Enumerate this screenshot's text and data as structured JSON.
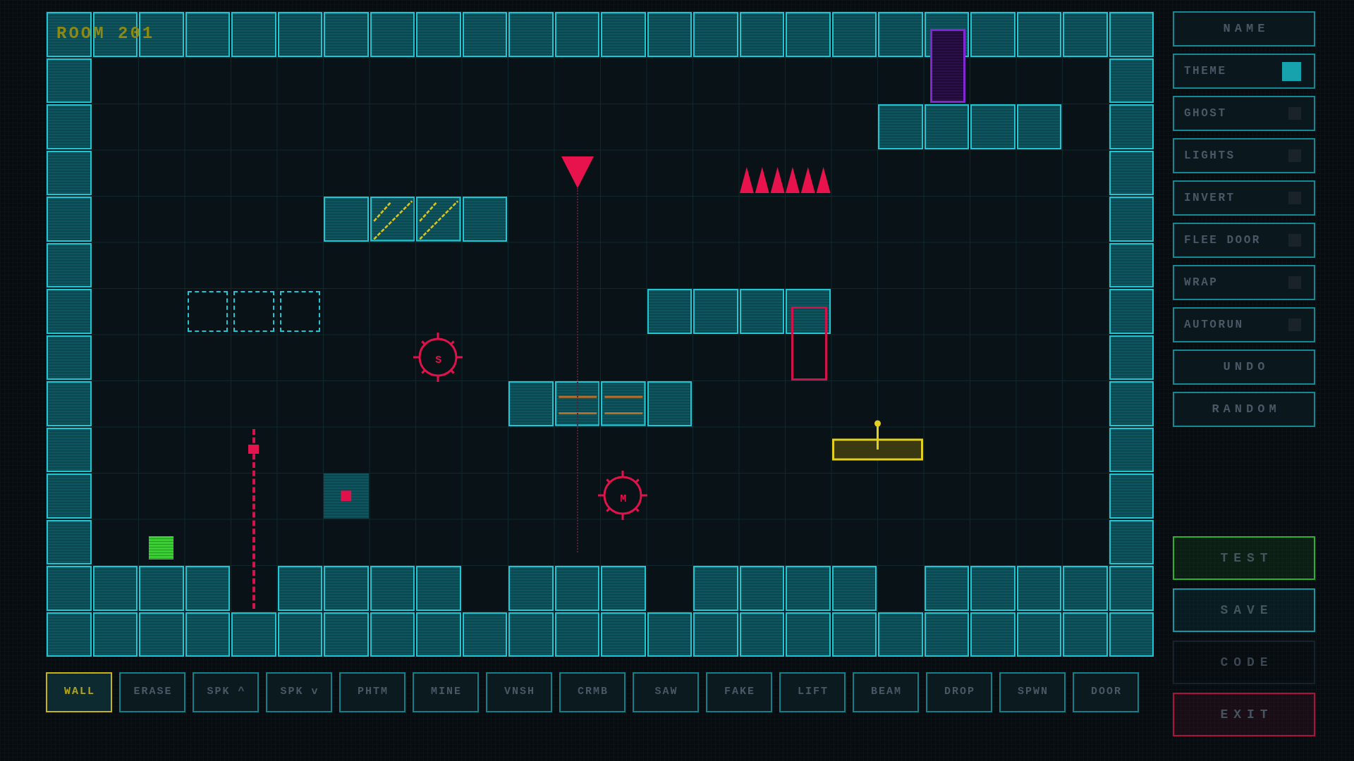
{
  "title": "ROOM 201",
  "map": {
    "rows": [
      [
        {
          "kind": "wall"
        },
        {
          "kind": "wall"
        },
        {
          "kind": "wall"
        },
        {
          "kind": "wall"
        },
        {
          "kind": "wall"
        },
        {
          "kind": "wall"
        },
        {
          "kind": "wall"
        },
        {
          "kind": "wall"
        },
        {
          "kind": "wall"
        },
        {
          "kind": "wall"
        },
        {
          "kind": "wall"
        },
        {
          "kind": "wall"
        },
        {
          "kind": "wall"
        },
        {
          "kind": "wall"
        },
        {
          "kind": "wall"
        },
        {
          "kind": "wall"
        },
        {
          "kind": "wall"
        },
        {
          "kind": "wall"
        },
        {
          "kind": "wall"
        },
        {
          "kind": "wall"
        },
        {
          "kind": "wall"
        },
        {
          "kind": "wall"
        },
        {
          "kind": "wall"
        },
        {
          "kind": "wall"
        }
      ],
      [
        {
          "kind": "wall"
        },
        {
          "kind": "empty"
        },
        {
          "kind": "empty"
        },
        {
          "kind": "empty"
        },
        {
          "kind": "empty"
        },
        {
          "kind": "empty"
        },
        {
          "kind": "empty"
        },
        {
          "kind": "empty"
        },
        {
          "kind": "empty"
        },
        {
          "kind": "empty"
        },
        {
          "kind": "empty"
        },
        {
          "kind": "empty"
        },
        {
          "kind": "empty"
        },
        {
          "kind": "empty"
        },
        {
          "kind": "empty"
        },
        {
          "kind": "empty"
        },
        {
          "kind": "empty"
        },
        {
          "kind": "empty"
        },
        {
          "kind": "empty"
        },
        {
          "kind": "door"
        },
        {
          "kind": "empty"
        },
        {
          "kind": "empty"
        },
        {
          "kind": "empty"
        },
        {
          "kind": "wall"
        }
      ],
      [
        {
          "kind": "wall"
        },
        {
          "kind": "empty"
        },
        {
          "kind": "empty"
        },
        {
          "kind": "empty"
        },
        {
          "kind": "empty"
        },
        {
          "kind": "empty"
        },
        {
          "kind": "empty"
        },
        {
          "kind": "empty"
        },
        {
          "kind": "empty"
        },
        {
          "kind": "empty"
        },
        {
          "kind": "empty"
        },
        {
          "kind": "empty"
        },
        {
          "kind": "empty"
        },
        {
          "kind": "empty"
        },
        {
          "kind": "empty"
        },
        {
          "kind": "empty"
        },
        {
          "kind": "empty"
        },
        {
          "kind": "empty"
        },
        {
          "kind": "wall"
        },
        {
          "kind": "wall"
        },
        {
          "kind": "wall"
        },
        {
          "kind": "wall"
        },
        {
          "kind": "empty"
        },
        {
          "kind": "wall"
        }
      ],
      [
        {
          "kind": "wall"
        },
        {
          "kind": "empty"
        },
        {
          "kind": "empty"
        },
        {
          "kind": "empty"
        },
        {
          "kind": "empty"
        },
        {
          "kind": "empty"
        },
        {
          "kind": "empty"
        },
        {
          "kind": "empty"
        },
        {
          "kind": "empty"
        },
        {
          "kind": "empty"
        },
        {
          "kind": "empty"
        },
        {
          "kind": "drop"
        },
        {
          "kind": "empty"
        },
        {
          "kind": "empty"
        },
        {
          "kind": "empty"
        },
        {
          "kind": "spikes"
        },
        {
          "kind": "spikes"
        },
        {
          "kind": "empty"
        },
        {
          "kind": "empty"
        },
        {
          "kind": "empty"
        },
        {
          "kind": "empty"
        },
        {
          "kind": "empty"
        },
        {
          "kind": "empty"
        },
        {
          "kind": "wall"
        }
      ],
      [
        {
          "kind": "wall"
        },
        {
          "kind": "empty"
        },
        {
          "kind": "empty"
        },
        {
          "kind": "empty"
        },
        {
          "kind": "empty"
        },
        {
          "kind": "empty"
        },
        {
          "kind": "wall"
        },
        {
          "kind": "crumble"
        },
        {
          "kind": "crumble"
        },
        {
          "kind": "wall"
        },
        {
          "kind": "empty"
        },
        {
          "kind": "empty"
        },
        {
          "kind": "empty"
        },
        {
          "kind": "empty"
        },
        {
          "kind": "empty"
        },
        {
          "kind": "empty"
        },
        {
          "kind": "empty"
        },
        {
          "kind": "empty"
        },
        {
          "kind": "empty"
        },
        {
          "kind": "empty"
        },
        {
          "kind": "empty"
        },
        {
          "kind": "empty"
        },
        {
          "kind": "empty"
        },
        {
          "kind": "wall"
        }
      ],
      [
        {
          "kind": "wall"
        },
        {
          "kind": "empty"
        },
        {
          "kind": "empty"
        },
        {
          "kind": "empty"
        },
        {
          "kind": "empty"
        },
        {
          "kind": "empty"
        },
        {
          "kind": "empty"
        },
        {
          "kind": "empty"
        },
        {
          "kind": "empty"
        },
        {
          "kind": "empty"
        },
        {
          "kind": "empty"
        },
        {
          "kind": "empty"
        },
        {
          "kind": "empty"
        },
        {
          "kind": "empty"
        },
        {
          "kind": "empty"
        },
        {
          "kind": "empty"
        },
        {
          "kind": "empty"
        },
        {
          "kind": "empty"
        },
        {
          "kind": "empty"
        },
        {
          "kind": "empty"
        },
        {
          "kind": "empty"
        },
        {
          "kind": "empty"
        },
        {
          "kind": "empty"
        },
        {
          "kind": "wall"
        }
      ],
      [
        {
          "kind": "wall"
        },
        {
          "kind": "empty"
        },
        {
          "kind": "empty"
        },
        {
          "kind": "phantom"
        },
        {
          "kind": "phantom"
        },
        {
          "kind": "phantom"
        },
        {
          "kind": "empty"
        },
        {
          "kind": "empty"
        },
        {
          "kind": "empty"
        },
        {
          "kind": "empty"
        },
        {
          "kind": "empty"
        },
        {
          "kind": "empty"
        },
        {
          "kind": "empty"
        },
        {
          "kind": "wall"
        },
        {
          "kind": "wall"
        },
        {
          "kind": "wall"
        },
        {
          "kind": "wall"
        },
        {
          "kind": "empty"
        },
        {
          "kind": "empty"
        },
        {
          "kind": "empty"
        },
        {
          "kind": "empty"
        },
        {
          "kind": "empty"
        },
        {
          "kind": "empty"
        },
        {
          "kind": "wall"
        }
      ],
      [
        {
          "kind": "wall"
        },
        {
          "kind": "empty"
        },
        {
          "kind": "empty"
        },
        {
          "kind": "empty"
        },
        {
          "kind": "empty"
        },
        {
          "kind": "empty"
        },
        {
          "kind": "empty"
        },
        {
          "kind": "empty"
        },
        {
          "kind": "saw",
          "label": "S"
        },
        {
          "kind": "empty"
        },
        {
          "kind": "empty"
        },
        {
          "kind": "empty"
        },
        {
          "kind": "empty"
        },
        {
          "kind": "empty"
        },
        {
          "kind": "empty"
        },
        {
          "kind": "empty"
        },
        {
          "kind": "frame"
        },
        {
          "kind": "empty"
        },
        {
          "kind": "empty"
        },
        {
          "kind": "empty"
        },
        {
          "kind": "empty"
        },
        {
          "kind": "empty"
        },
        {
          "kind": "empty"
        },
        {
          "kind": "wall"
        }
      ],
      [
        {
          "kind": "wall"
        },
        {
          "kind": "empty"
        },
        {
          "kind": "empty"
        },
        {
          "kind": "empty"
        },
        {
          "kind": "empty"
        },
        {
          "kind": "empty"
        },
        {
          "kind": "empty"
        },
        {
          "kind": "empty"
        },
        {
          "kind": "empty"
        },
        {
          "kind": "empty"
        },
        {
          "kind": "wall"
        },
        {
          "kind": "vanish"
        },
        {
          "kind": "vanish"
        },
        {
          "kind": "wall"
        },
        {
          "kind": "empty"
        },
        {
          "kind": "empty"
        },
        {
          "kind": "empty"
        },
        {
          "kind": "empty"
        },
        {
          "kind": "empty"
        },
        {
          "kind": "empty"
        },
        {
          "kind": "empty"
        },
        {
          "kind": "empty"
        },
        {
          "kind": "empty"
        },
        {
          "kind": "wall"
        }
      ],
      [
        {
          "kind": "wall"
        },
        {
          "kind": "empty"
        },
        {
          "kind": "empty"
        },
        {
          "kind": "empty"
        },
        {
          "kind": "beam"
        },
        {
          "kind": "empty"
        },
        {
          "kind": "empty"
        },
        {
          "kind": "empty"
        },
        {
          "kind": "empty"
        },
        {
          "kind": "empty"
        },
        {
          "kind": "empty"
        },
        {
          "kind": "empty"
        },
        {
          "kind": "empty"
        },
        {
          "kind": "empty"
        },
        {
          "kind": "empty"
        },
        {
          "kind": "empty"
        },
        {
          "kind": "empty"
        },
        {
          "kind": "lift"
        },
        {
          "kind": "empty"
        },
        {
          "kind": "empty"
        },
        {
          "kind": "empty"
        },
        {
          "kind": "empty"
        },
        {
          "kind": "empty"
        },
        {
          "kind": "wall"
        }
      ],
      [
        {
          "kind": "wall"
        },
        {
          "kind": "empty"
        },
        {
          "kind": "empty"
        },
        {
          "kind": "empty"
        },
        {
          "kind": "empty"
        },
        {
          "kind": "empty"
        },
        {
          "kind": "fake"
        },
        {
          "kind": "empty"
        },
        {
          "kind": "empty"
        },
        {
          "kind": "empty"
        },
        {
          "kind": "empty"
        },
        {
          "kind": "empty"
        },
        {
          "kind": "mine",
          "label": "M"
        },
        {
          "kind": "empty"
        },
        {
          "kind": "empty"
        },
        {
          "kind": "empty"
        },
        {
          "kind": "empty"
        },
        {
          "kind": "empty"
        },
        {
          "kind": "empty"
        },
        {
          "kind": "empty"
        },
        {
          "kind": "empty"
        },
        {
          "kind": "empty"
        },
        {
          "kind": "empty"
        },
        {
          "kind": "wall"
        }
      ],
      [
        {
          "kind": "wall"
        },
        {
          "kind": "empty"
        },
        {
          "kind": "spawn"
        },
        {
          "kind": "empty"
        },
        {
          "kind": "empty"
        },
        {
          "kind": "empty"
        },
        {
          "kind": "empty"
        },
        {
          "kind": "empty"
        },
        {
          "kind": "empty"
        },
        {
          "kind": "empty"
        },
        {
          "kind": "empty"
        },
        {
          "kind": "empty"
        },
        {
          "kind": "empty"
        },
        {
          "kind": "empty"
        },
        {
          "kind": "empty"
        },
        {
          "kind": "empty"
        },
        {
          "kind": "empty"
        },
        {
          "kind": "empty"
        },
        {
          "kind": "empty"
        },
        {
          "kind": "empty"
        },
        {
          "kind": "empty"
        },
        {
          "kind": "empty"
        },
        {
          "kind": "empty"
        },
        {
          "kind": "wall"
        }
      ],
      [
        {
          "kind": "wall"
        },
        {
          "kind": "wall"
        },
        {
          "kind": "wall"
        },
        {
          "kind": "wall"
        },
        {
          "kind": "empty"
        },
        {
          "kind": "wall"
        },
        {
          "kind": "wall"
        },
        {
          "kind": "wall"
        },
        {
          "kind": "wall"
        },
        {
          "kind": "empty"
        },
        {
          "kind": "wall"
        },
        {
          "kind": "wall"
        },
        {
          "kind": "wall"
        },
        {
          "kind": "empty"
        },
        {
          "kind": "wall"
        },
        {
          "kind": "wall"
        },
        {
          "kind": "wall"
        },
        {
          "kind": "wall"
        },
        {
          "kind": "empty"
        },
        {
          "kind": "wall"
        },
        {
          "kind": "wall"
        },
        {
          "kind": "wall"
        },
        {
          "kind": "wall"
        },
        {
          "kind": "wall"
        }
      ],
      [
        {
          "kind": "wall"
        },
        {
          "kind": "wall"
        },
        {
          "kind": "wall"
        },
        {
          "kind": "wall"
        },
        {
          "kind": "wall"
        },
        {
          "kind": "wall"
        },
        {
          "kind": "wall"
        },
        {
          "kind": "wall"
        },
        {
          "kind": "wall"
        },
        {
          "kind": "wall"
        },
        {
          "kind": "wall"
        },
        {
          "kind": "wall"
        },
        {
          "kind": "wall"
        },
        {
          "kind": "wall"
        },
        {
          "kind": "wall"
        },
        {
          "kind": "wall"
        },
        {
          "kind": "wall"
        },
        {
          "kind": "wall"
        },
        {
          "kind": "wall"
        },
        {
          "kind": "wall"
        },
        {
          "kind": "wall"
        },
        {
          "kind": "wall"
        },
        {
          "kind": "wall"
        },
        {
          "kind": "wall"
        }
      ]
    ]
  },
  "tools": [
    {
      "label": "WALL",
      "selected": true
    },
    {
      "label": "ERASE",
      "selected": false
    },
    {
      "label": "SPK ^",
      "selected": false
    },
    {
      "label": "SPK v",
      "selected": false
    },
    {
      "label": "PHTM",
      "selected": false
    },
    {
      "label": "MINE",
      "selected": false
    },
    {
      "label": "VNSH",
      "selected": false
    },
    {
      "label": "CRMB",
      "selected": false
    },
    {
      "label": "SAW",
      "selected": false
    },
    {
      "label": "FAKE",
      "selected": false
    },
    {
      "label": "LIFT",
      "selected": false
    },
    {
      "label": "BEAM",
      "selected": false
    },
    {
      "label": "DROP",
      "selected": false
    },
    {
      "label": "SPWN",
      "selected": false
    },
    {
      "label": "DOOR",
      "selected": false
    }
  ],
  "sidebar": {
    "items": [
      {
        "kind": "button",
        "label": "NAME"
      },
      {
        "kind": "swatch",
        "label": "THEME",
        "color": "#17a3ae"
      },
      {
        "kind": "toggle",
        "label": "GHOST",
        "on": false
      },
      {
        "kind": "toggle",
        "label": "LIGHTS",
        "on": false
      },
      {
        "kind": "toggle",
        "label": "INVERT",
        "on": false
      },
      {
        "kind": "toggle",
        "label": "FLEE DOOR",
        "on": false
      },
      {
        "kind": "toggle",
        "label": "WRAP",
        "on": false
      },
      {
        "kind": "toggle",
        "label": "AUTORUN",
        "on": false
      },
      {
        "kind": "button",
        "label": "UNDO"
      },
      {
        "kind": "button",
        "label": "RANDOM"
      }
    ],
    "actions": [
      {
        "label": "TEST",
        "color": "#2bb22b",
        "disabled": false
      },
      {
        "label": "SAVE",
        "color": "#1497a3",
        "disabled": false
      },
      {
        "label": "CODE",
        "color": "#18222a",
        "disabled": true
      },
      {
        "label": "EXIT",
        "color": "#b0103d",
        "disabled": false
      }
    ]
  }
}
